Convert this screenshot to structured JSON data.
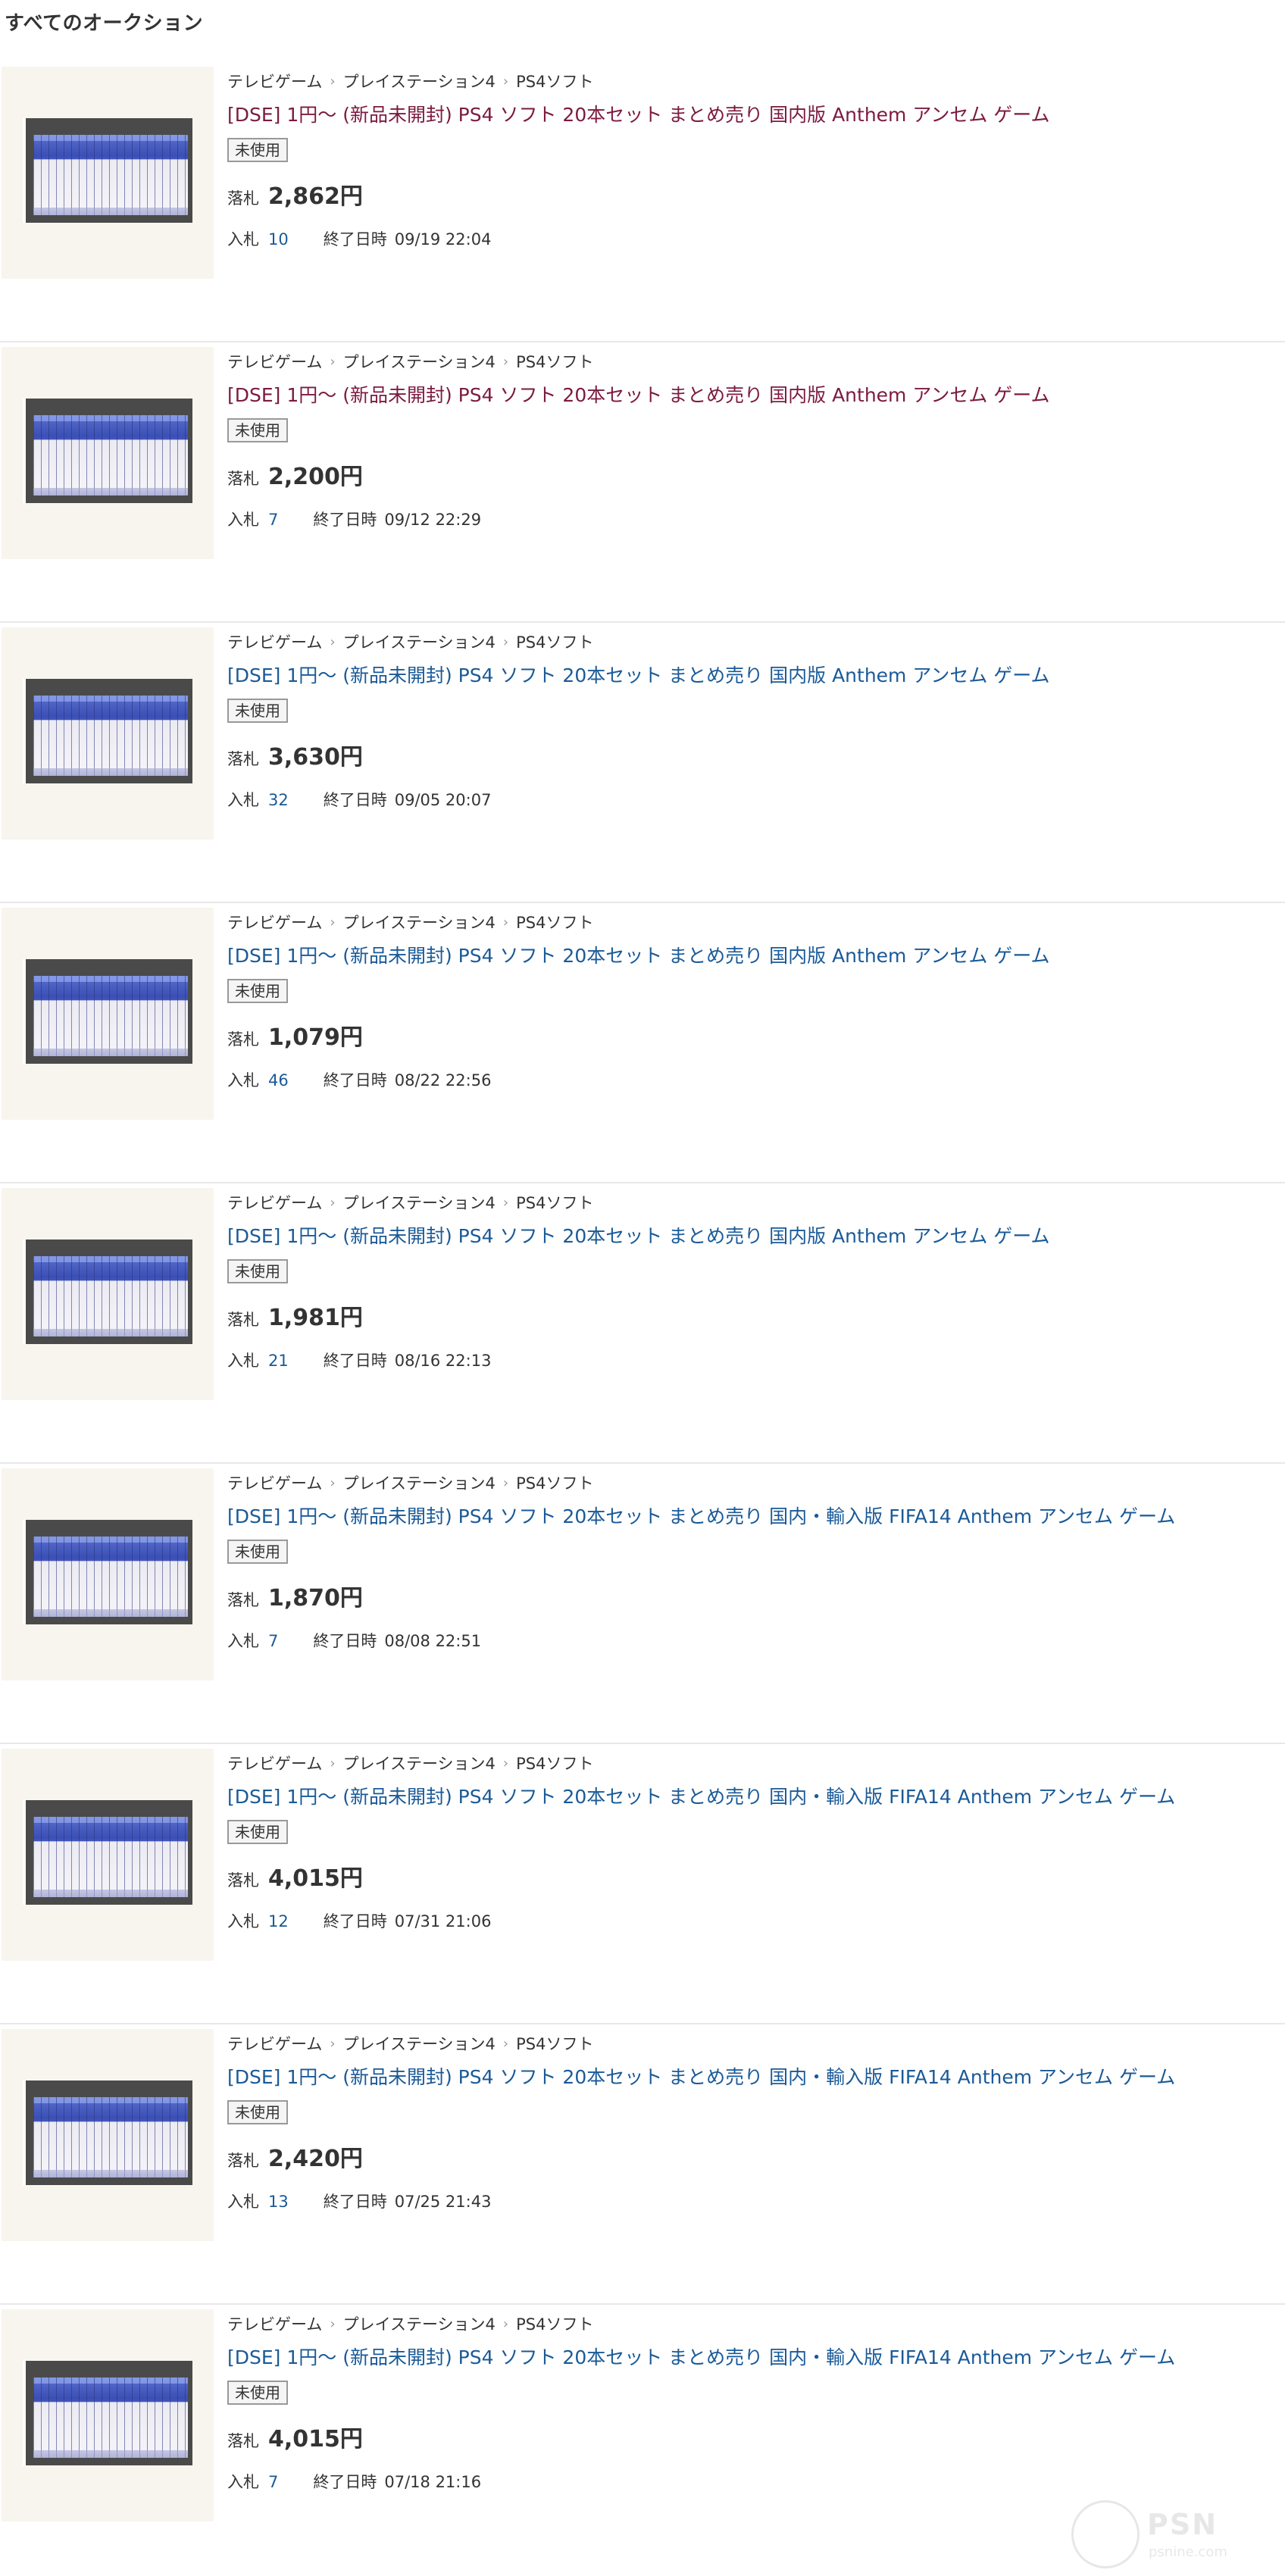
{
  "page": {
    "title": "すべてのオークション"
  },
  "breadcrumb": {
    "cat1": "テレビゲーム",
    "cat2": "プレイステーション4",
    "cat3": "PS4ソフト",
    "sep": ">"
  },
  "labels": {
    "price": "落札",
    "bids": "入札",
    "end": "終了日時"
  },
  "items": [
    {
      "title": "[DSE] 1円～ (新品未開封) PS4 ソフト 20本セット まとめ売り 国内版 Anthem アンセム ゲーム",
      "condition": "未使用",
      "price": "2,862円",
      "bids": "10",
      "end": "09/19 22:04",
      "visited": true
    },
    {
      "title": "[DSE] 1円～ (新品未開封) PS4 ソフト 20本セット まとめ売り 国内版 Anthem アンセム ゲーム",
      "condition": "未使用",
      "price": "2,200円",
      "bids": "7",
      "end": "09/12 22:29",
      "visited": true
    },
    {
      "title": "[DSE] 1円～ (新品未開封) PS4 ソフト 20本セット まとめ売り 国内版 Anthem アンセム ゲーム",
      "condition": "未使用",
      "price": "3,630円",
      "bids": "32",
      "end": "09/05 20:07",
      "visited": false
    },
    {
      "title": "[DSE] 1円～ (新品未開封) PS4 ソフト 20本セット まとめ売り 国内版 Anthem アンセム ゲーム",
      "condition": "未使用",
      "price": "1,079円",
      "bids": "46",
      "end": "08/22 22:56",
      "visited": false
    },
    {
      "title": "[DSE] 1円～ (新品未開封) PS4 ソフト 20本セット まとめ売り 国内版 Anthem アンセム ゲーム",
      "condition": "未使用",
      "price": "1,981円",
      "bids": "21",
      "end": "08/16 22:13",
      "visited": false
    },
    {
      "title": "[DSE] 1円～ (新品未開封) PS4 ソフト 20本セット まとめ売り 国内・輸入版 FIFA14 Anthem アンセム ゲーム",
      "condition": "未使用",
      "price": "1,870円",
      "bids": "7",
      "end": "08/08 22:51",
      "visited": false
    },
    {
      "title": "[DSE] 1円～ (新品未開封) PS4 ソフト 20本セット まとめ売り 国内・輸入版 FIFA14 Anthem アンセム ゲーム",
      "condition": "未使用",
      "price": "4,015円",
      "bids": "12",
      "end": "07/31 21:06",
      "visited": false
    },
    {
      "title": "[DSE] 1円～ (新品未開封) PS4 ソフト 20本セット まとめ売り 国内・輸入版 FIFA14 Anthem アンセム ゲーム",
      "condition": "未使用",
      "price": "2,420円",
      "bids": "13",
      "end": "07/25 21:43",
      "visited": false
    },
    {
      "title": "[DSE] 1円～ (新品未開封) PS4 ソフト 20本セット まとめ売り 国内・輸入版 FIFA14 Anthem アンセム ゲーム",
      "condition": "未使用",
      "price": "4,015円",
      "bids": "7",
      "end": "07/18 21:16",
      "visited": false
    }
  ],
  "colors": {
    "visited_link": "#7c1a40",
    "link": "#1a5a98",
    "thumb_bg": "#f7f5ee"
  },
  "watermark": {
    "main": "PSN",
    "sub": "psnine.com"
  }
}
